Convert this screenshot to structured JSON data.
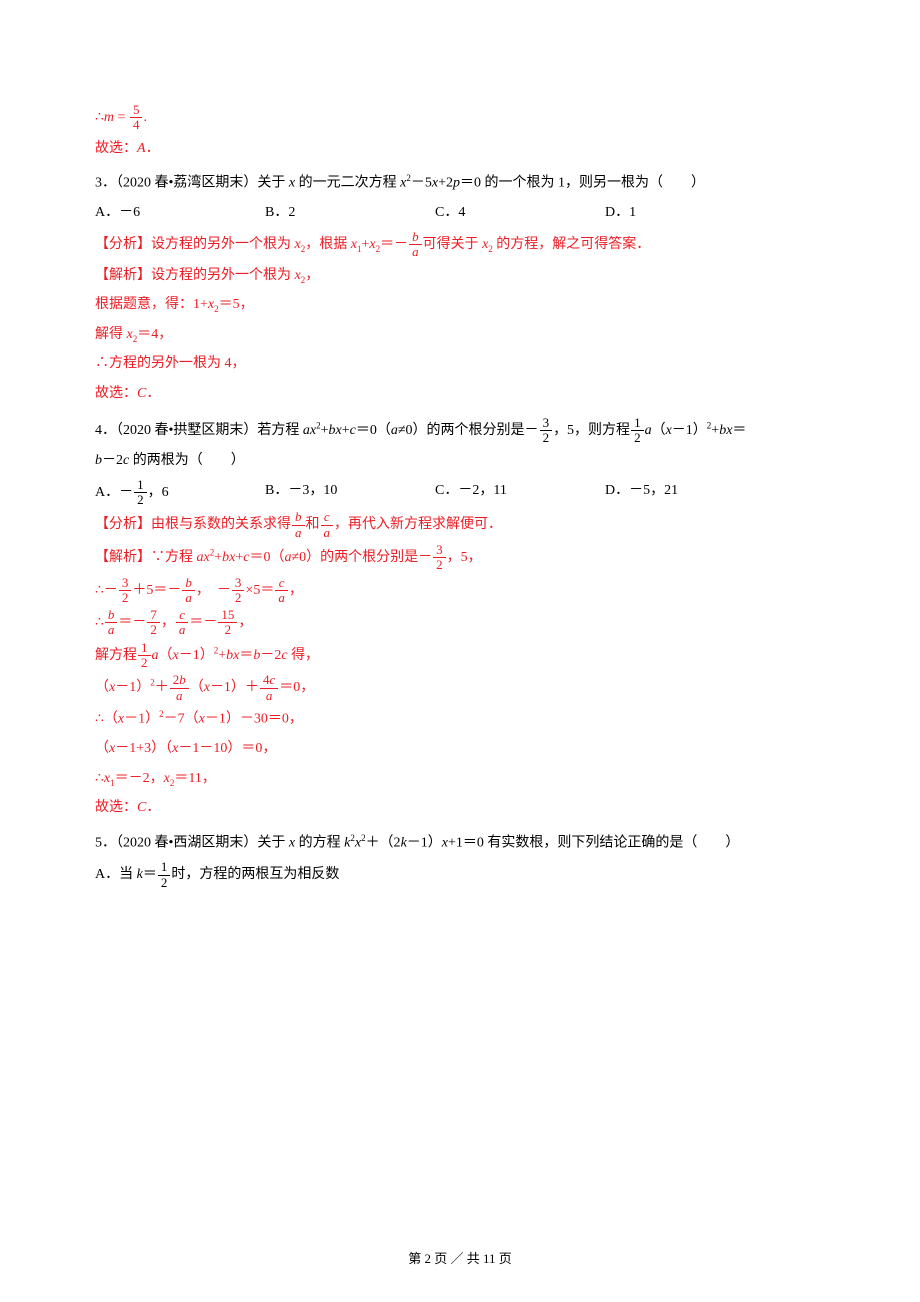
{
  "top": {
    "eq": "∴",
    "m_eq": "=",
    "frac_num": "5",
    "frac_den": "4",
    "period": ".",
    "choice": "故选：",
    "choice_ans": "A",
    "choice_dot": "．"
  },
  "q3": {
    "num": "3．",
    "source": "（2020 春•荔湾区期末）关于 ",
    "var_x": "x",
    "txt1": " 的一元二次方程 ",
    "expr_a": "x",
    "sup2": "2",
    "expr_b": "－5",
    "expr_c": "+2",
    "var_p": "p",
    "expr_d": "＝0 的一个根为 1，则另一根为（　　）",
    "opts": {
      "A": "A．－6",
      "B": "B．2",
      "C": "C．4",
      "D": "D．1"
    },
    "ana_lbl": "【分析】",
    "ana_a": "设方程的另外一个根为 ",
    "x2": "x",
    "ana_b": "，根据 ",
    "x1": "x",
    "plus": "+",
    "eqneg": "＝－",
    "frac_b": "b",
    "frac_a": "a",
    "ana_c": "可得关于 ",
    "ana_d": " 的方程，解之可得答案．",
    "sol_lbl": "【解析】",
    "sol_a": "设方程的另外一个根为 ",
    "sol_b": "，",
    "step1_a": "根据题意，得：1+",
    "step1_b": "＝5，",
    "step2_a": "解得 ",
    "step2_b": "＝4，",
    "step3": "∴方程的另外一根为 4，",
    "choice": "故选：",
    "choice_ans": "C",
    "choice_dot": "．"
  },
  "q4": {
    "num": "4．",
    "source": "（2020 春•拱墅区期末）若方程 ",
    "a": "a",
    "x": "x",
    "b": "b",
    "c": "c",
    "sup2": "2",
    "plus": "+",
    "eq0": "＝0（",
    "ne0": "≠0）的两个根分别是－",
    "frac3": "3",
    "frac2": "2",
    "comma5": "，5，则方程",
    "frac1": "1",
    "paren_x1": "（",
    "minus1": "－1）",
    "plus_bx": "+",
    "eq_line2a": "＝",
    "line2_a": "b",
    "line2_b": "－2",
    "line2_c": "c",
    "line2_tail": " 的两根为（　　）",
    "opts": {
      "A_lbl": "A．",
      "A_neg": "－",
      "A_num": "1",
      "A_den": "2",
      "A_tail": "，6",
      "B": "B．－3，10",
      "C": "C．－2，11",
      "D": "D．－5，21"
    },
    "ana_lbl": "【分析】",
    "ana_a": "由根与系数的关系求得",
    "and": "和",
    "ana_b": "，再代入新方程求解便可．",
    "sol_lbl": "【解析】",
    "sol_a": "∵方程 ",
    "sol_b": "＝0（",
    "sol_c": "≠0）的两个根分别是－",
    "sol_d": "，5，",
    "s1_a": "∴－",
    "s1_b": "＋5＝－",
    "s1_c": "，　－",
    "s1_d": "×5＝",
    "s1_e": "，",
    "s2_a": "∴",
    "s2_eq": "＝－",
    "s2_7": "7",
    "s2_2": "2",
    "s2_comma": "，",
    "s2_15": "15",
    "s3_a": "解方程",
    "s3_b": "（",
    "s3_c": "－1）",
    "s3_d": "+",
    "s3_e": "＝",
    "s3_f": "－2",
    "s3_g": " 得，",
    "s4_a": "（",
    "s4_b": "－1）",
    "s4_c": "＋",
    "s4_2b": "2",
    "s4_d": "（",
    "s4_e": "－1）＋",
    "s4_4c": "4",
    "s4_f": "＝0，",
    "s5_a": "∴（",
    "s5_b": "－1）",
    "s5_c": "－7（",
    "s5_d": "－1）－30＝0，",
    "s6_a": "（",
    "s6_b": "－1+3）（",
    "s6_c": "－1－10）＝0，",
    "s7_a": "∴",
    "s7_x1": "x",
    "s7_b": "＝－2，",
    "s7_x2": "x",
    "s7_c": "＝11，",
    "choice": "故选：",
    "choice_ans": "C",
    "choice_dot": "．"
  },
  "q5": {
    "num": "5．",
    "source": "（2020 春•西湖区期末）关于 ",
    "x": "x",
    "txt1": " 的方程 ",
    "k": "k",
    "sup2": "2",
    "txt2": "＋（2",
    "txt3": "－1）",
    "txt4": "+1＝0 有实数根，则下列结论正确的是（　　）",
    "optA_a": "A．当 ",
    "optA_eq": "＝",
    "optA_num": "1",
    "optA_den": "2",
    "optA_b": "时，方程的两根互为相反数"
  },
  "footer": {
    "a": "第 ",
    "cur": "2",
    "b": " 页 ／ 共 ",
    "tot": "11",
    "c": " 页"
  }
}
